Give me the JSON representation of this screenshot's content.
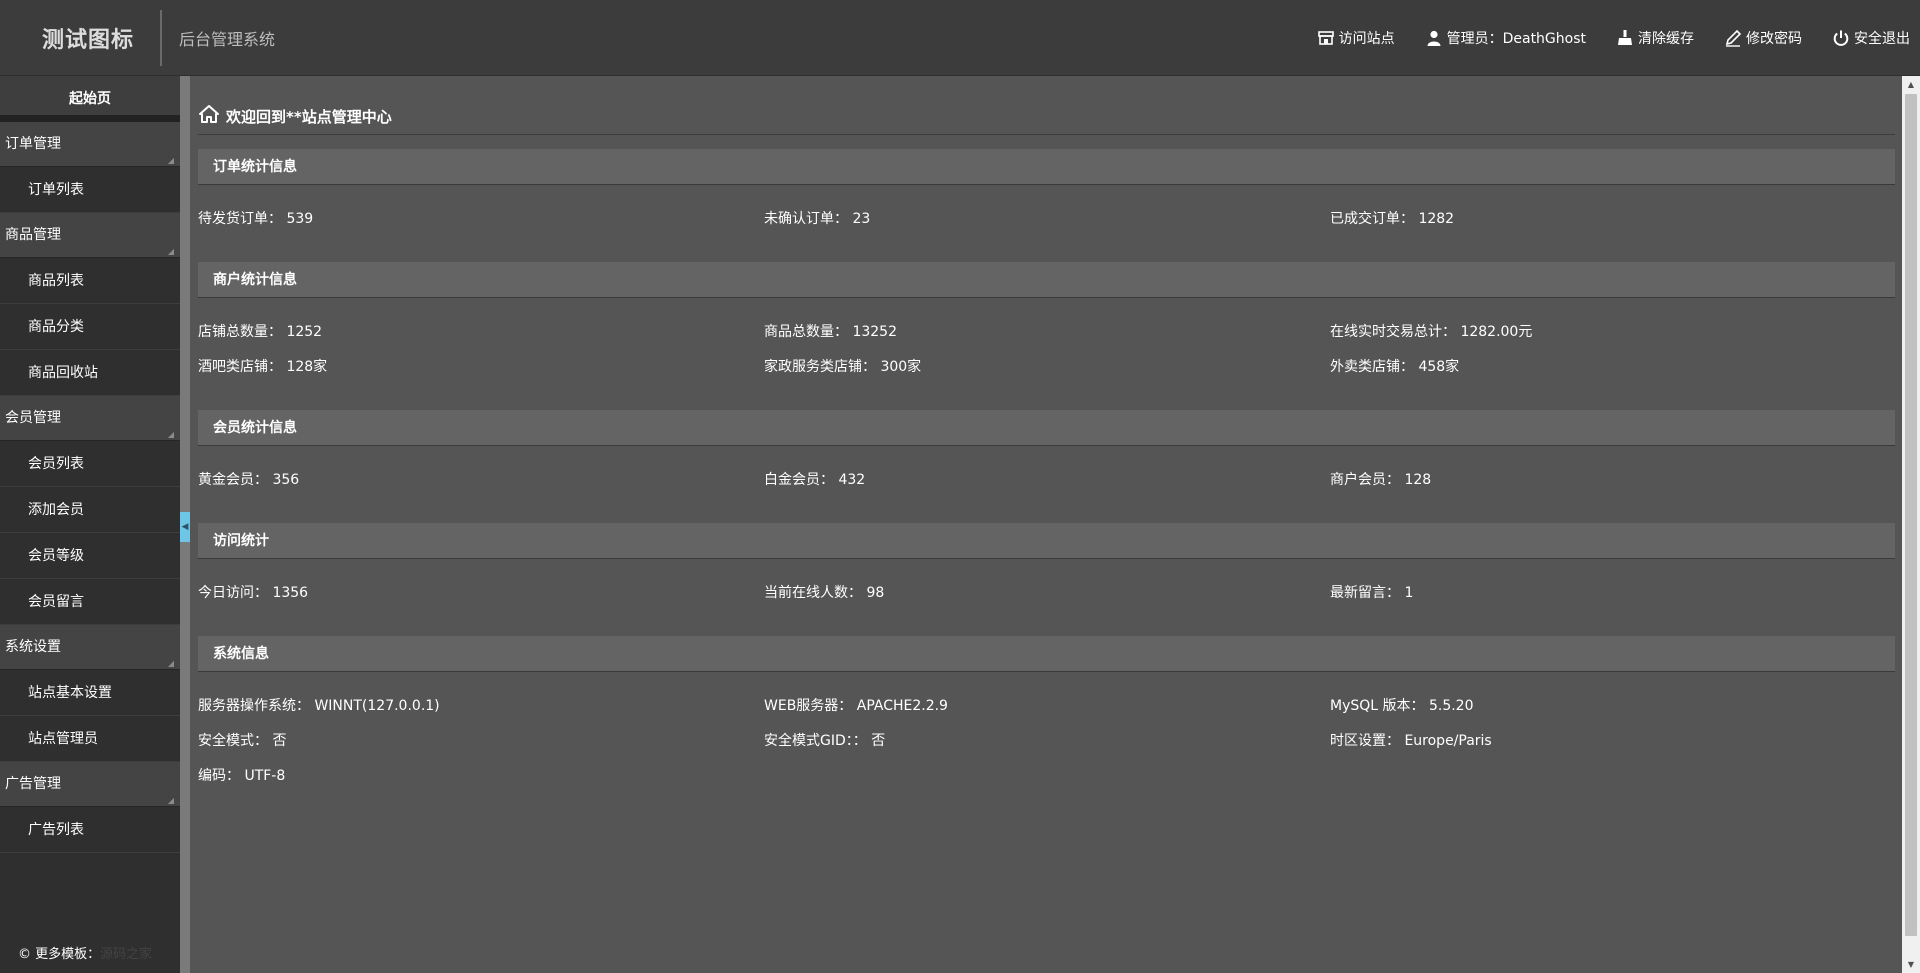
{
  "header": {
    "logo": "测试图标",
    "subtitle": "后台管理系统",
    "nav": [
      {
        "label": "访问站点",
        "icon": "store-icon"
      },
      {
        "label": "管理员：DeathGhost",
        "icon": "user-icon"
      },
      {
        "label": "清除缓存",
        "icon": "broom-icon"
      },
      {
        "label": "修改密码",
        "icon": "pen-icon"
      },
      {
        "label": "安全退出",
        "icon": "power-icon"
      }
    ]
  },
  "sidebar": {
    "home": "起始页",
    "groups": [
      {
        "title": "订单管理",
        "items": [
          "订单列表"
        ]
      },
      {
        "title": "商品管理",
        "items": [
          "商品列表",
          "商品分类",
          "商品回收站"
        ]
      },
      {
        "title": "会员管理",
        "items": [
          "会员列表",
          "添加会员",
          "会员等级",
          "会员留言"
        ]
      },
      {
        "title": "系统设置",
        "items": [
          "站点基本设置",
          "站点管理员"
        ]
      },
      {
        "title": "广告管理",
        "items": [
          "广告列表"
        ]
      }
    ],
    "footer": {
      "prefix": "© 更多模板：",
      "link": "源码之家"
    }
  },
  "main": {
    "welcome": "欢迎回到**站点管理中心",
    "sections": [
      {
        "title": "订单统计信息",
        "rows": [
          [
            "待发货订单： 539",
            "未确认订单： 23",
            "已成交订单： 1282"
          ]
        ]
      },
      {
        "title": "商户统计信息",
        "rows": [
          [
            "店铺总数量： 1252",
            "商品总数量： 13252",
            "在线实时交易总计： 1282.00元"
          ],
          [
            "酒吧类店铺： 128家",
            "家政服务类店铺： 300家",
            "外卖类店铺： 458家"
          ]
        ]
      },
      {
        "title": "会员统计信息",
        "rows": [
          [
            "黄金会员： 356",
            "白金会员： 432",
            "商户会员： 128"
          ]
        ]
      },
      {
        "title": "访问统计",
        "rows": [
          [
            "今日访问： 1356",
            "当前在线人数： 98",
            "最新留言： 1"
          ]
        ]
      },
      {
        "title": "系统信息",
        "rows": [
          [
            "服务器操作系统： WINNT(127.0.0.1)",
            "WEB服务器： APACHE2.2.9",
            "MySQL 版本： 5.5.20"
          ],
          [
            "安全模式： 否",
            "安全模式GID：： 否",
            "时区设置： Europe/Paris"
          ],
          [
            "编码： UTF-8",
            "",
            ""
          ]
        ]
      }
    ]
  }
}
